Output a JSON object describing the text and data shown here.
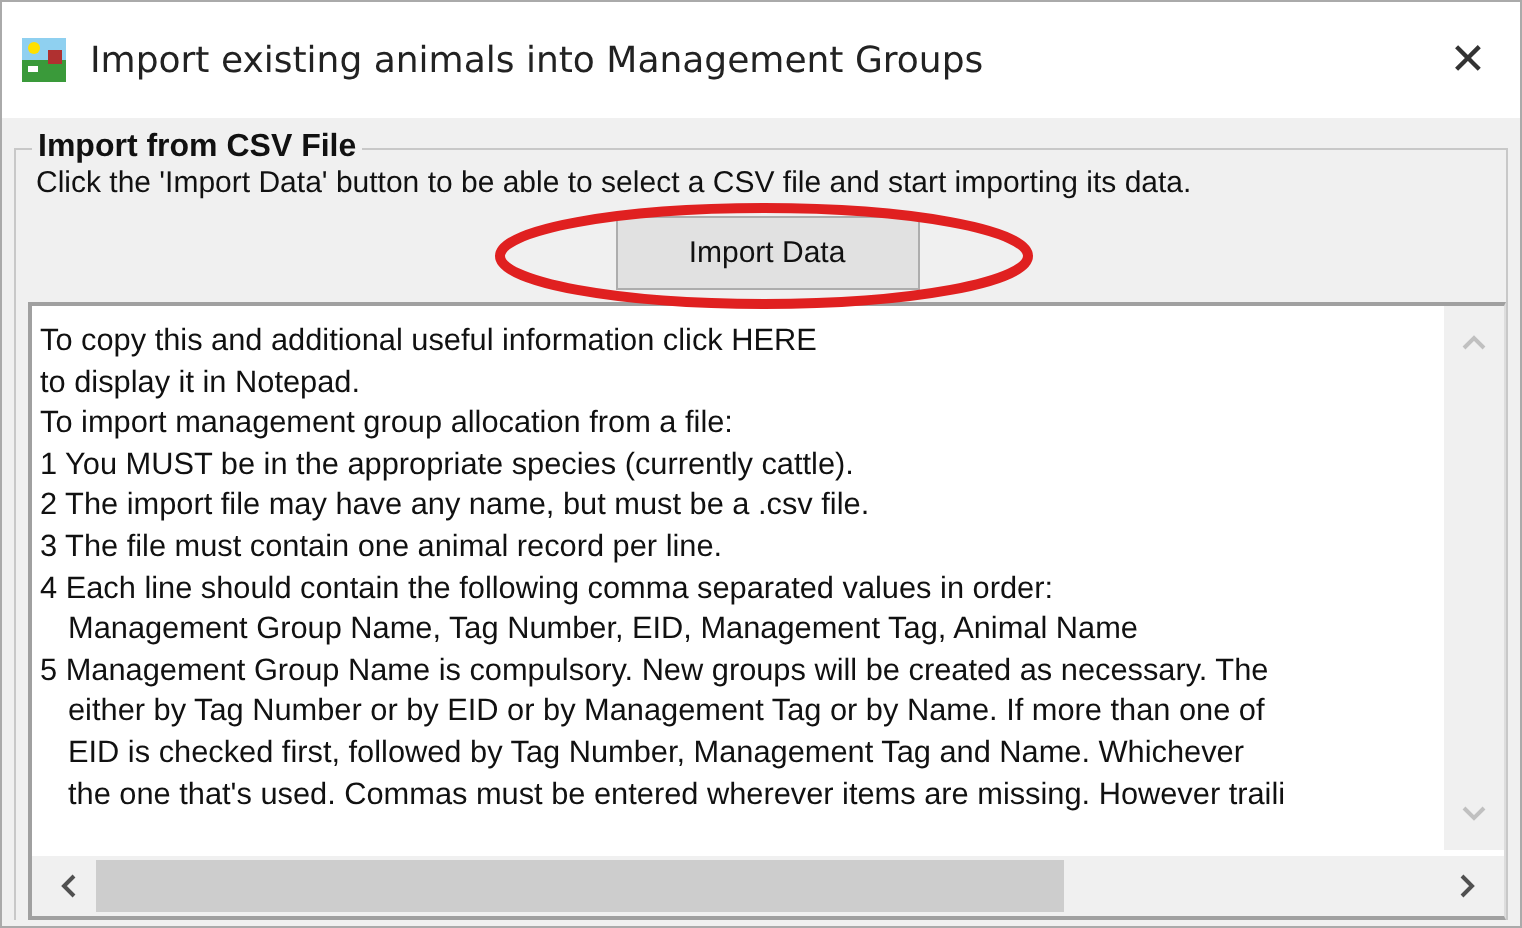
{
  "window": {
    "title": "Import existing animals into Management Groups",
    "close": "✕"
  },
  "group": {
    "title": "Import from CSV File",
    "instruction": "Click the 'Import Data' button to be able to select a CSV file and start importing its data.",
    "button": "Import Data"
  },
  "memo": {
    "lines": [
      {
        "text": "To copy this and additional useful information click HERE",
        "indent": false
      },
      {
        "text": "to display it in Notepad.",
        "indent": false
      },
      {
        "text": "To import management group allocation from a file:",
        "indent": false
      },
      {
        "text": "1 You MUST be in the appropriate species (currently cattle).",
        "indent": false
      },
      {
        "text": "2 The import file may have any name, but must be a .csv file.",
        "indent": false
      },
      {
        "text": "3 The file must contain one animal record per line.",
        "indent": false
      },
      {
        "text": "4 Each line should contain the following comma separated values in order:",
        "indent": false
      },
      {
        "text": "Management Group Name, Tag Number, EID, Management Tag, Animal Name",
        "indent": true
      },
      {
        "text": "5 Management Group Name is compulsory. New groups will be created as necessary. The",
        "indent": false
      },
      {
        "text": "either by Tag Number or by EID or by Management Tag or by Name. If more than one of",
        "indent": true
      },
      {
        "text": "EID is checked first, followed by Tag Number, Management Tag and Name. Whichever",
        "indent": true
      },
      {
        "text": "the one that's used. Commas must be entered wherever items are missing. However traili",
        "indent": true
      }
    ]
  }
}
